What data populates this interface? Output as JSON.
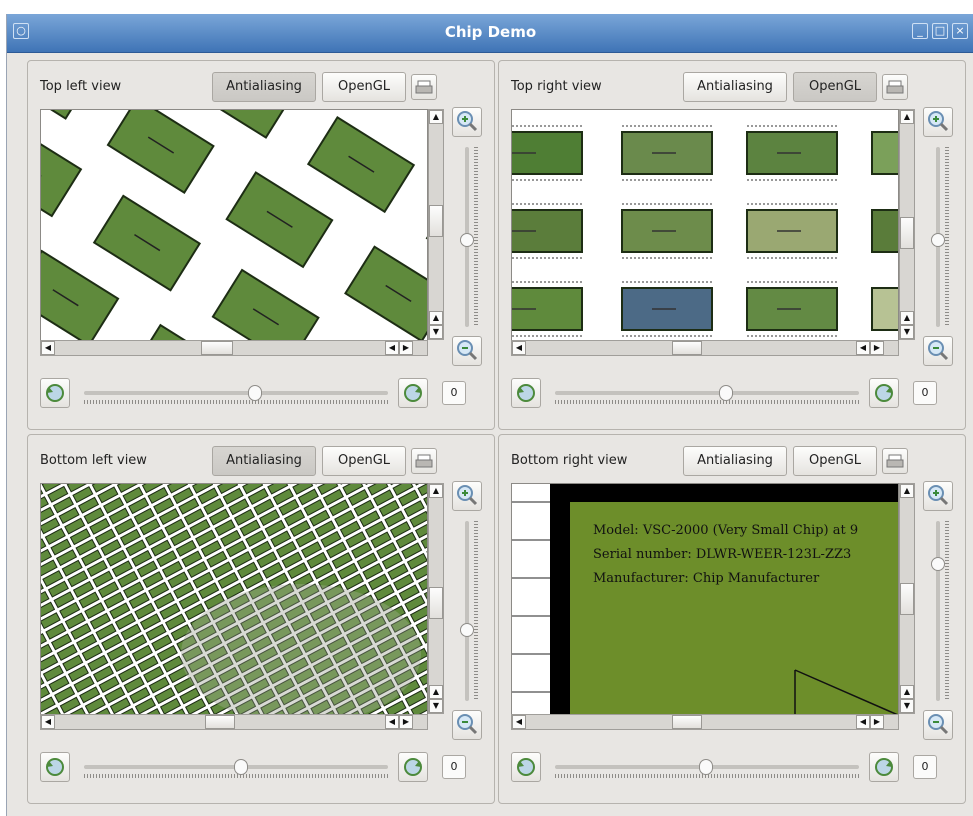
{
  "window": {
    "title": "Chip Demo"
  },
  "panels": [
    {
      "title": "Top left view",
      "antialiasing_label": "Antialiasing",
      "opengl_label": "OpenGL",
      "antialiasing_on": true,
      "opengl_on": false,
      "rotation_value": "0"
    },
    {
      "title": "Top right view",
      "antialiasing_label": "Antialiasing",
      "opengl_label": "OpenGL",
      "antialiasing_on": false,
      "opengl_on": true,
      "rotation_value": "0"
    },
    {
      "title": "Bottom left view",
      "antialiasing_label": "Antialiasing",
      "opengl_label": "OpenGL",
      "antialiasing_on": true,
      "opengl_on": false,
      "rotation_value": "0"
    },
    {
      "title": "Bottom right view",
      "antialiasing_label": "Antialiasing",
      "opengl_label": "OpenGL",
      "antialiasing_on": false,
      "opengl_on": false,
      "rotation_value": "0"
    }
  ],
  "chip_info": {
    "model": "Model: VSC-2000 (Very Small Chip) at 9",
    "serial": "Serial number: DLWR-WEER-123L-ZZ3",
    "manufacturer": "Manufacturer: Chip Manufacturer"
  },
  "colors": {
    "chip_green": "#5d8a3a",
    "chip_blue": "#4c6a86",
    "chip_pale": "#9aaa78",
    "board_green": "#6d8e2a"
  },
  "icons": {
    "print": "printer-icon",
    "zoom_in": "zoom-in-icon",
    "zoom_out": "zoom-out-icon",
    "rotate_left": "rotate-left-icon",
    "rotate_right": "rotate-right-icon"
  }
}
